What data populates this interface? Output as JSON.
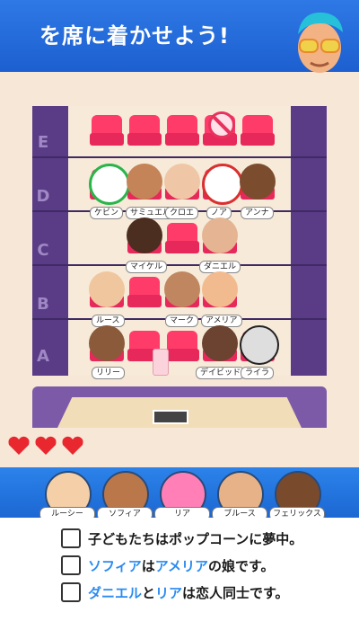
{
  "header": {
    "title": "を席に着かせよう!"
  },
  "theater": {
    "rows": [
      "E",
      "D",
      "C",
      "B",
      "A"
    ],
    "seated": {
      "D": [
        "ケビン",
        "サミュエル",
        "クロエ",
        "ノア",
        "アンナ"
      ],
      "C": [
        "マイケル",
        "ダニエル"
      ],
      "B": [
        "ルース",
        "マーク",
        "アメリア"
      ],
      "A": [
        "リリー",
        "デイビッド",
        "ライラ"
      ]
    }
  },
  "hearts": {
    "count": 3,
    "color": "#e8272f"
  },
  "character_bar": {
    "items": [
      "ルーシー",
      "ソフィア",
      "リア",
      "ブルース",
      "フェリックス"
    ]
  },
  "clues": {
    "c1": {
      "text": "子どもたちはポップコーンに夢中。"
    },
    "c2": {
      "p1": "ソフィア",
      "p2": "は",
      "p3": "アメリア",
      "p4": "の娘です。"
    },
    "c3": {
      "p1": "ダニエル",
      "p2": "と",
      "p3": "リア",
      "p4": "は恋人同士です。"
    }
  },
  "colors": {
    "accent_blue": "#2a8bf0",
    "seat_red": "#ff3b6a",
    "header_blue": "#1d5fd0"
  }
}
